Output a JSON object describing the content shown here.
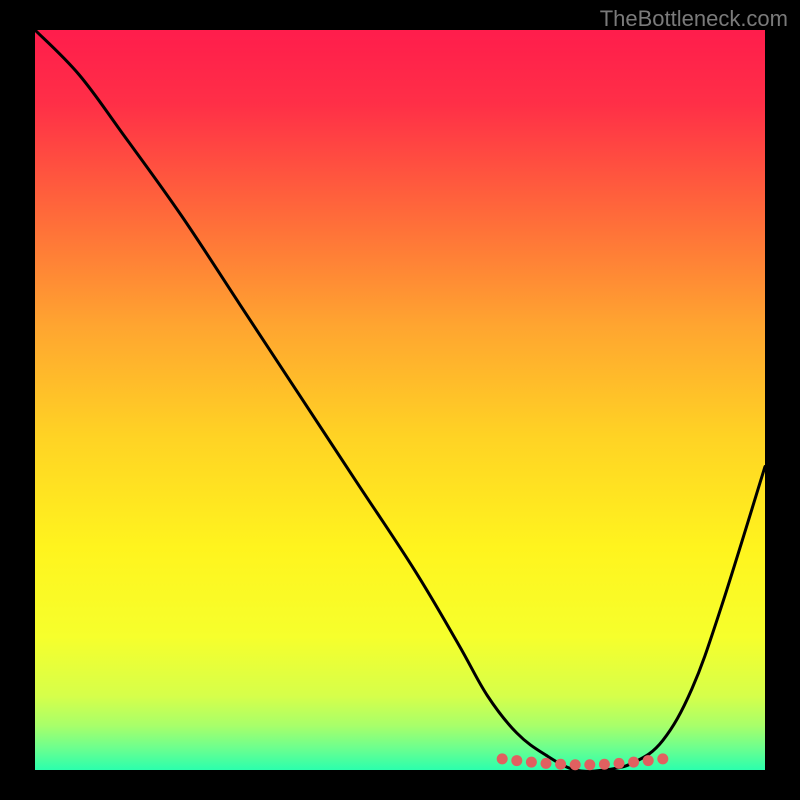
{
  "attribution": "TheBottleneck.com",
  "colors": {
    "frame": "#000000",
    "gradient_stops": [
      {
        "offset": 0.0,
        "color": "#ff1d4c"
      },
      {
        "offset": 0.1,
        "color": "#ff2f47"
      },
      {
        "offset": 0.25,
        "color": "#ff6a3a"
      },
      {
        "offset": 0.4,
        "color": "#ffa530"
      },
      {
        "offset": 0.55,
        "color": "#ffd324"
      },
      {
        "offset": 0.7,
        "color": "#fff41e"
      },
      {
        "offset": 0.82,
        "color": "#f6ff2c"
      },
      {
        "offset": 0.9,
        "color": "#d6ff4a"
      },
      {
        "offset": 0.94,
        "color": "#a8ff6a"
      },
      {
        "offset": 0.97,
        "color": "#6dff8e"
      },
      {
        "offset": 1.0,
        "color": "#2bffad"
      }
    ],
    "curve": "#000000",
    "accent_dots": "#e16060"
  },
  "chart_data": {
    "type": "line",
    "title": "",
    "xlabel": "",
    "ylabel": "",
    "xlim": [
      0,
      100
    ],
    "ylim": [
      0,
      100
    ],
    "series": [
      {
        "name": "bottleneck-curve",
        "x": [
          0,
          6,
          12,
          20,
          28,
          36,
          44,
          52,
          58,
          62,
          66,
          70,
          74,
          78,
          82,
          86,
          90,
          94,
          100
        ],
        "y": [
          100,
          94,
          86,
          75,
          63,
          51,
          39,
          27,
          17,
          10,
          5,
          2,
          0,
          0,
          1,
          4,
          11,
          22,
          41
        ]
      }
    ],
    "accent_region": {
      "x_start": 64,
      "x_end": 86,
      "y": 1.5
    }
  }
}
